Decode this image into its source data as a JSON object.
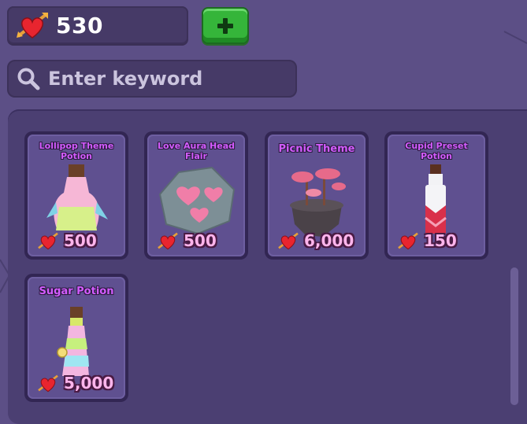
{
  "currency": {
    "amount": "530",
    "icon": "heart-arrow-icon",
    "add_icon": "plus-icon"
  },
  "search": {
    "placeholder": "Enter keyword",
    "value": "",
    "icon": "search-icon"
  },
  "items": [
    {
      "name": "Lollipop Theme Potion",
      "price": "500",
      "art": "lollipop-potion"
    },
    {
      "name": "Love Aura Head Flair",
      "price": "500",
      "art": "heart-rock"
    },
    {
      "name": "Picnic Theme",
      "price": "6,000",
      "art": "floating-island"
    },
    {
      "name": "Cupid Preset Potion",
      "price": "150",
      "art": "cupid-bottle"
    },
    {
      "name": "Sugar Potion",
      "price": "5,000",
      "art": "rainbow-bottle"
    }
  ],
  "colors": {
    "background": "#5c4f86",
    "panel": "#4b3f72",
    "card": "#5f5090",
    "title": "#d35cff",
    "price": "#ffb5ec",
    "add_button": "#35b53a"
  }
}
